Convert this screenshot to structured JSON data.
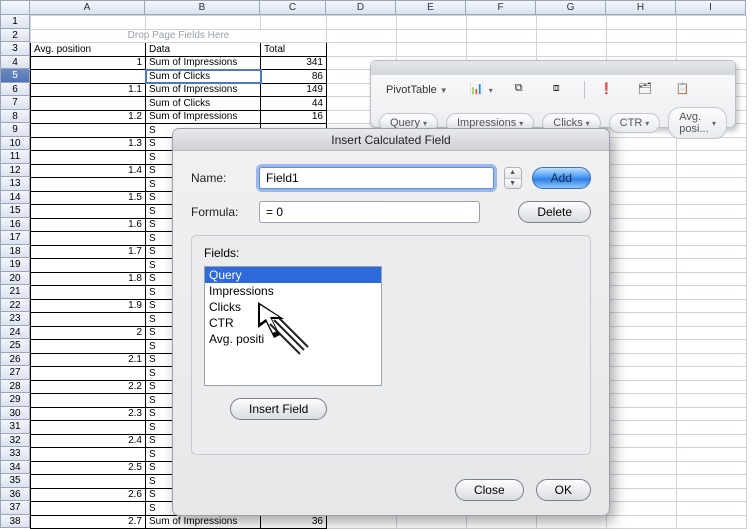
{
  "sheet": {
    "columns": [
      "A",
      "B",
      "C",
      "D",
      "E",
      "F",
      "G",
      "H",
      "I"
    ],
    "drop_hint": "Drop Page Fields Here",
    "header": {
      "col_a": "Avg. position",
      "col_b": "Data",
      "col_c": "Total"
    },
    "rows": [
      {
        "a": "1",
        "b": "Sum of Impressions",
        "c": "341"
      },
      {
        "a": "",
        "b": "Sum of Clicks",
        "c": "86"
      },
      {
        "a": "1.1",
        "b": "Sum of Impressions",
        "c": "149"
      },
      {
        "a": "",
        "b": "Sum of Clicks",
        "c": "44"
      },
      {
        "a": "1.2",
        "b": "Sum of Impressions",
        "c": "16"
      },
      {
        "a": "",
        "b": "S",
        "c": ""
      },
      {
        "a": "1.3",
        "b": "S",
        "c": ""
      },
      {
        "a": "",
        "b": "S",
        "c": ""
      },
      {
        "a": "1.4",
        "b": "S",
        "c": ""
      },
      {
        "a": "",
        "b": "S",
        "c": ""
      },
      {
        "a": "1.5",
        "b": "S",
        "c": ""
      },
      {
        "a": "",
        "b": "S",
        "c": ""
      },
      {
        "a": "1.6",
        "b": "S",
        "c": ""
      },
      {
        "a": "",
        "b": "S",
        "c": ""
      },
      {
        "a": "1.7",
        "b": "S",
        "c": ""
      },
      {
        "a": "",
        "b": "S",
        "c": ""
      },
      {
        "a": "1.8",
        "b": "S",
        "c": ""
      },
      {
        "a": "",
        "b": "S",
        "c": ""
      },
      {
        "a": "1.9",
        "b": "S",
        "c": ""
      },
      {
        "a": "",
        "b": "S",
        "c": ""
      },
      {
        "a": "2",
        "b": "S",
        "c": ""
      },
      {
        "a": "",
        "b": "S",
        "c": ""
      },
      {
        "a": "2.1",
        "b": "S",
        "c": ""
      },
      {
        "a": "",
        "b": "S",
        "c": ""
      },
      {
        "a": "2.2",
        "b": "S",
        "c": ""
      },
      {
        "a": "",
        "b": "S",
        "c": ""
      },
      {
        "a": "2.3",
        "b": "S",
        "c": ""
      },
      {
        "a": "",
        "b": "S",
        "c": ""
      },
      {
        "a": "2.4",
        "b": "S",
        "c": ""
      },
      {
        "a": "",
        "b": "S",
        "c": ""
      },
      {
        "a": "2.5",
        "b": "S",
        "c": ""
      },
      {
        "a": "",
        "b": "S",
        "c": ""
      },
      {
        "a": "2.6",
        "b": "S",
        "c": ""
      },
      {
        "a": "",
        "b": "S",
        "c": ""
      },
      {
        "a": "2.7",
        "b": "Sum of Impressions",
        "c": "36"
      }
    ],
    "selected_row_index": 5
  },
  "toolbar": {
    "pivot_label": "PivotTable",
    "pills": [
      "Query",
      "Impressions",
      "Clicks",
      "CTR",
      "Avg. posi..."
    ]
  },
  "dialog": {
    "title": "Insert Calculated Field",
    "name_label": "Name:",
    "name_value": "Field1",
    "formula_label": "Formula:",
    "formula_value": "= 0",
    "add_label": "Add",
    "delete_label": "Delete",
    "fields_label": "Fields:",
    "fields": [
      "Query",
      "Impressions",
      "Clicks",
      "CTR",
      "Avg. positi"
    ],
    "fields_selected_index": 0,
    "insert_field_label": "Insert Field",
    "close_label": "Close",
    "ok_label": "OK"
  }
}
